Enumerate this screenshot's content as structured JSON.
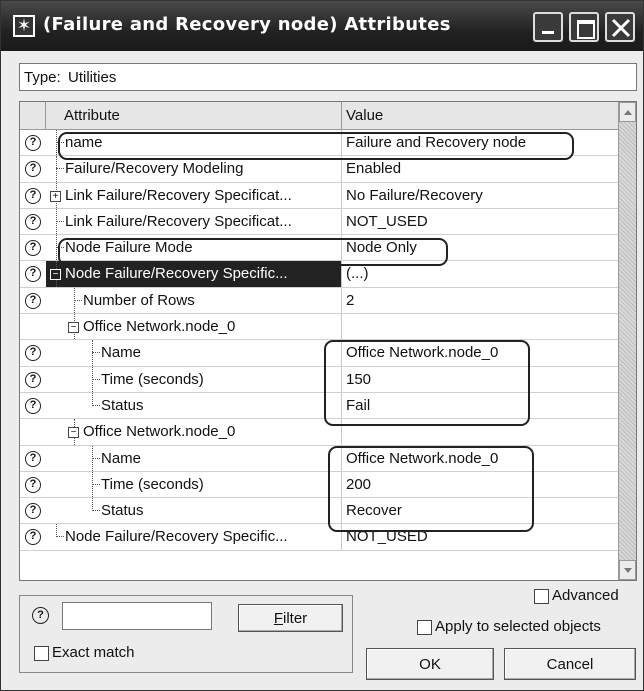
{
  "window": {
    "title": "(Failure and Recovery node) Attributes",
    "title_icon": "asterisk-icon"
  },
  "type_field": {
    "label": "Type:",
    "value": "Utilities"
  },
  "table": {
    "headers": {
      "attribute": "Attribute",
      "value": "Value"
    },
    "rows": [
      {
        "attr": "name",
        "value": "Failure and Recovery node",
        "indent": 0,
        "help": true,
        "expander": "",
        "highlight": true
      },
      {
        "attr": "Failure/Recovery Modeling",
        "value": "Enabled",
        "indent": 0,
        "help": true,
        "expander": ""
      },
      {
        "attr": "Link Failure/Recovery Specificat...",
        "value": "No Failure/Recovery",
        "indent": 0,
        "help": true,
        "expander": "+"
      },
      {
        "attr": "Link Failure/Recovery Specificat...",
        "value": "NOT_USED",
        "indent": 0,
        "help": true,
        "expander": ""
      },
      {
        "attr": "Node Failure Mode",
        "value": "Node Only",
        "indent": 0,
        "help": true,
        "expander": "",
        "highlight": true
      },
      {
        "attr": "Node Failure/Recovery Specific...",
        "value": "(...)",
        "indent": 0,
        "help": true,
        "expander": "-",
        "selected": true
      },
      {
        "attr": "Number of Rows",
        "value": "2",
        "indent": 1,
        "help": true,
        "expander": ""
      },
      {
        "attr": "Office Network.node_0",
        "value": "",
        "indent": 1,
        "help": false,
        "expander": "-"
      },
      {
        "attr": "Name",
        "value": "Office Network.node_0",
        "indent": 2,
        "help": true,
        "expander": ""
      },
      {
        "attr": "Time (seconds)",
        "value": "150",
        "indent": 2,
        "help": true,
        "expander": ""
      },
      {
        "attr": "Status",
        "value": "Fail",
        "indent": 2,
        "help": true,
        "expander": "",
        "last": true
      },
      {
        "attr": "Office Network.node_0",
        "value": "",
        "indent": 1,
        "help": false,
        "expander": "-"
      },
      {
        "attr": "Name",
        "value": "Office Network.node_0",
        "indent": 2,
        "help": true,
        "expander": ""
      },
      {
        "attr": "Time (seconds)",
        "value": "200",
        "indent": 2,
        "help": true,
        "expander": ""
      },
      {
        "attr": "Status",
        "value": "Recover",
        "indent": 2,
        "help": true,
        "expander": "",
        "last": true
      },
      {
        "attr": "Node Failure/Recovery Specific...",
        "value": "NOT_USED",
        "indent": 0,
        "help": true,
        "expander": "",
        "last": true
      }
    ]
  },
  "filter": {
    "input_value": "",
    "button": "Filter",
    "exact_match": "Exact match"
  },
  "options": {
    "advanced": "Advanced",
    "apply_selected": "Apply to selected objects"
  },
  "buttons": {
    "ok": "OK",
    "cancel": "Cancel"
  }
}
